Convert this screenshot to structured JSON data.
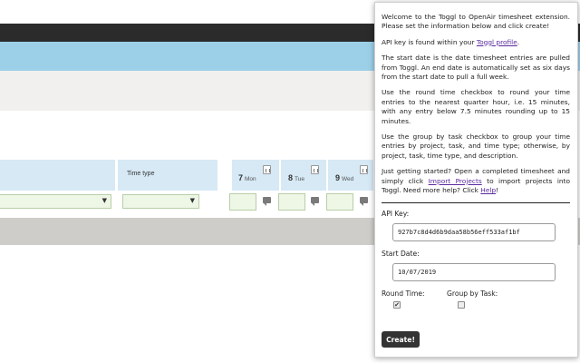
{
  "background": {
    "columns": {
      "time_type": "Time type"
    },
    "days": [
      {
        "num": "7",
        "weekday": "Mon"
      },
      {
        "num": "8",
        "weekday": "Tue"
      },
      {
        "num": "9",
        "weekday": "Wed"
      }
    ],
    "select_arrow": "▼"
  },
  "popup": {
    "intro": "Welcome to the Toggl to OpenAir timesheet extension. Please set the information below and click create!",
    "api_key_text": "API key is found within your ",
    "toggl_profile_link": "Toggl profile",
    "period": ".",
    "start_date_text": "The start date is the date timesheet entries are pulled from Toggl. An end date is automatically set as six days from the start date to pull a full week.",
    "round_text": "Use the round time checkbox to round your time entries to the nearest quarter hour, i.e. 15 minutes, with any entry below 7.5 minutes rounding up to 15 minutes.",
    "group_text": "Use the group by task checkbox to group your time entries by project, task, and time type; otherwise, by project, task, time type, and description.",
    "getting_started_1": "Just getting started? Open a completed timesheet and simply click ",
    "import_projects_link": "Import Projects",
    "getting_started_2": " to import projects into Toggl. Need more help? Click ",
    "help_link": "Help",
    "getting_started_3": "!",
    "api_key_label": "API Key:",
    "api_key_value": "927b7c8d4d6b9daa58b56eff533af1bf",
    "start_date_label": "Start Date:",
    "start_date_value": "10/07/2019",
    "round_time_label": "Round Time:",
    "group_by_task_label": "Group by Task:",
    "round_time_checked": true,
    "group_by_task_checked": false,
    "check_mark": "✔",
    "create_label": "Create!"
  },
  "colors": {
    "dark_bar": "#2b2b2b",
    "blue_bar": "#9ccfe8",
    "column_header": "#d6e9f5",
    "input_green": "#eef6e6",
    "button": "#333333",
    "link": "#5a2aa0"
  }
}
